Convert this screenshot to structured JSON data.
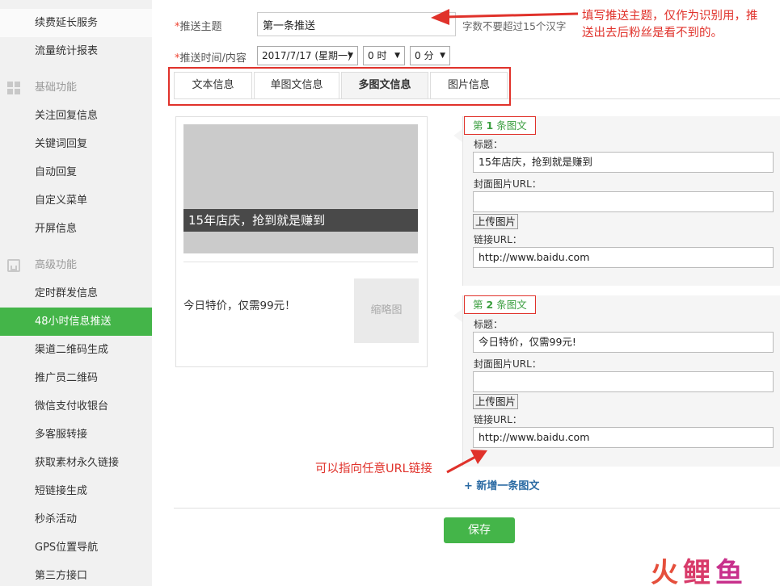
{
  "sidebar": {
    "items_top": [
      "续费延长服务",
      "流量统计报表"
    ],
    "group_basic": "基础功能",
    "basic_items": [
      "关注回复信息",
      "关键词回复",
      "自动回复",
      "自定义菜单",
      "开屏信息"
    ],
    "group_advanced": "高级功能",
    "advanced_items": [
      "定时群发信息",
      "48小时信息推送",
      "渠道二维码生成",
      "推广员二维码",
      "微信支付收银台",
      "多客服转接",
      "获取素材永久链接",
      "短链接生成",
      "秒杀活动",
      "GPS位置导航",
      "第三方接口"
    ],
    "active_item": "48小时信息推送"
  },
  "form": {
    "topic_label": "推送主题",
    "topic_value": "第一条推送",
    "topic_hint": "字数不要超过15个汉字",
    "time_label": "推送时间/内容",
    "required_mark": "*",
    "date_value": "2017/7/17 (星期一)",
    "hour_value": "0 时",
    "minute_value": "0 分",
    "select_arrow": "▼"
  },
  "tabs": [
    "文本信息",
    "单图文信息",
    "多图文信息",
    "图片信息"
  ],
  "active_tab": "多图文信息",
  "preview": {
    "cover_title": "15年店庆，抢到就是赚到",
    "sub_title": "今日特价，仅需99元！",
    "thumb_text": "缩略图"
  },
  "articles": [
    {
      "heading_prefix": "第",
      "heading_num": "1",
      "heading_suffix": "条图文",
      "title_label": "标题：",
      "title_value": "15年店庆，抢到就是赚到",
      "cover_label": "封面图片URL：",
      "cover_value": "",
      "upload_label": "上传图片",
      "link_label": "链接URL：",
      "link_value": "http://www.baidu.com"
    },
    {
      "heading_prefix": "第",
      "heading_num": "2",
      "heading_suffix": "条图文",
      "title_label": "标题：",
      "title_value": "今日特价，仅需99元!",
      "cover_label": "封面图片URL：",
      "cover_value": "",
      "upload_label": "上传图片",
      "link_label": "链接URL：",
      "link_value": "http://www.baidu.com"
    }
  ],
  "add_article": "+ 新增一条图文",
  "save_label": "保存",
  "annotations": {
    "topic_note_line1": "填写推送主题，仅作为识别用，推",
    "topic_note_line2": "送出去后粉丝是看不到的。",
    "url_note": "可以指向任意URL链接"
  },
  "watermark": {
    "c1": "火",
    "c2": "鲤",
    "c3": "鱼"
  },
  "colors": {
    "accent_green": "#44b549",
    "annotation_red": "#e0322b",
    "link_blue": "#2a6aa3"
  }
}
